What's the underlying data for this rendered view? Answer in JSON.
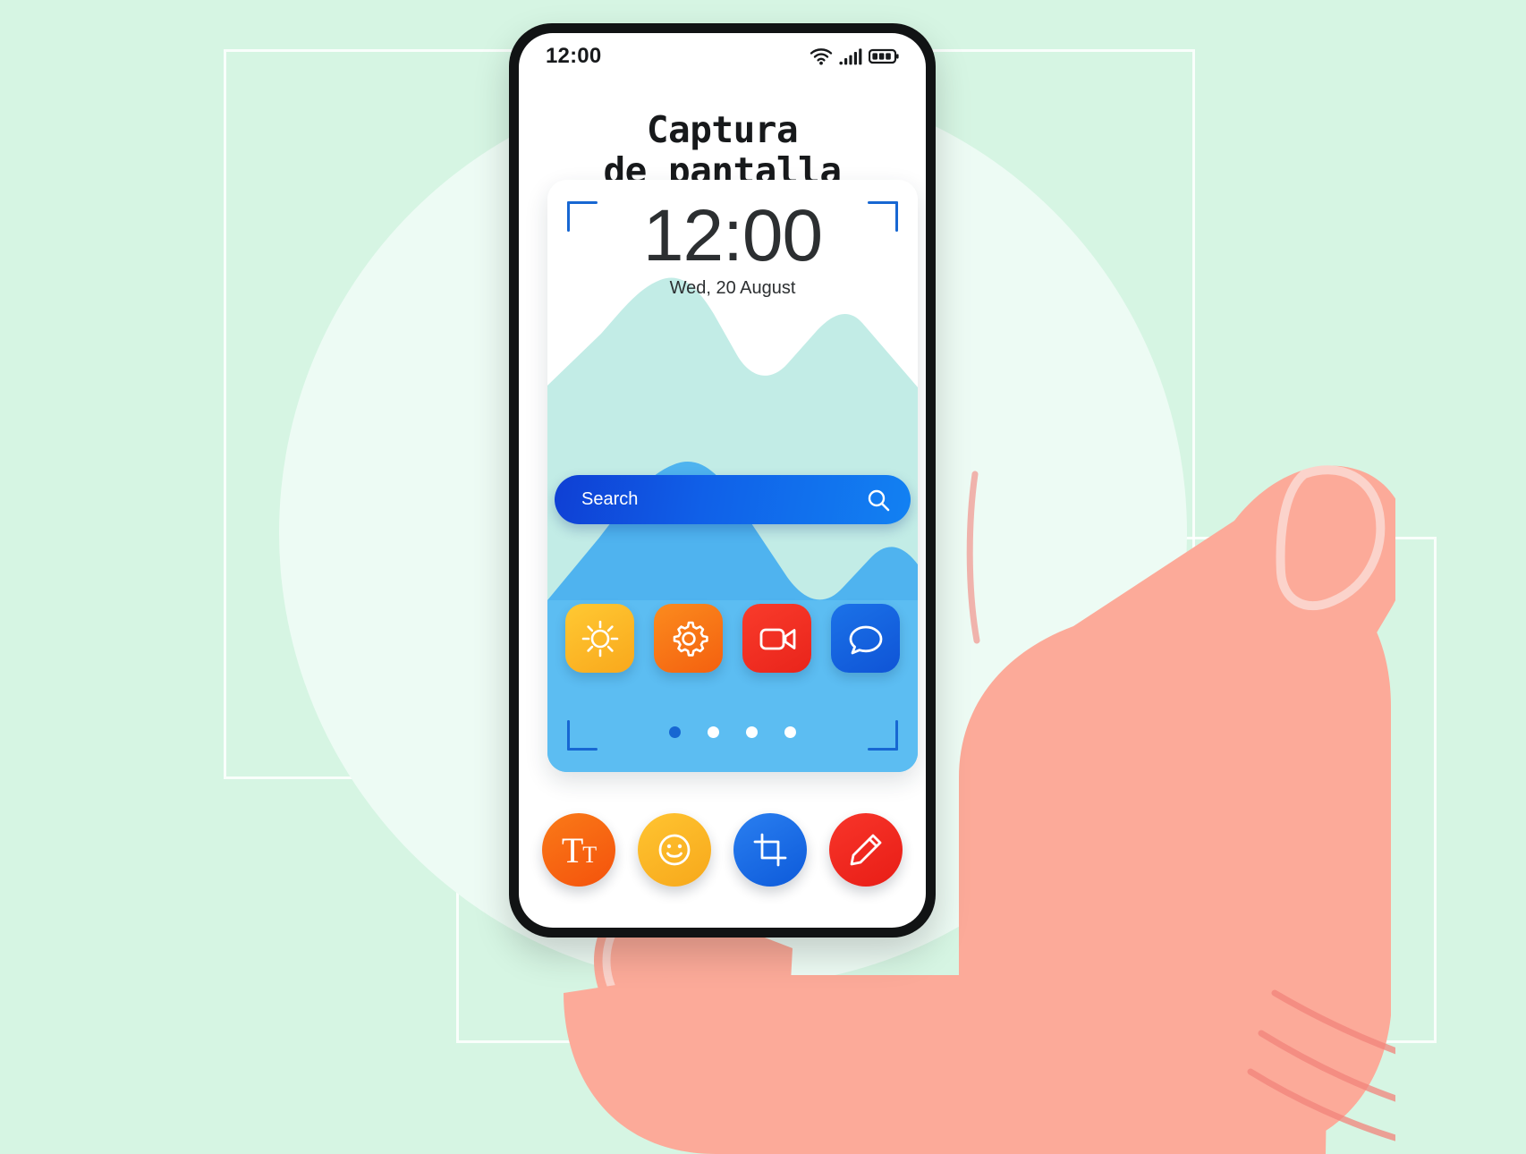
{
  "page": {
    "background_color": "#d6f5e3",
    "circle_color": "#edfbf4"
  },
  "phone": {
    "statusbar": {
      "time": "12:00",
      "wifi_icon": "wifi-icon",
      "signal_icon": "cellular-signal-icon",
      "battery_icon": "battery-icon"
    },
    "title_line1": "Captura",
    "title_line2": "de pantalla"
  },
  "screenshot_card": {
    "clock": {
      "time": "12:00",
      "date": "Wed, 20 August"
    },
    "brackets": {
      "color": "#1767d2",
      "names": [
        "crop-bracket-top-left",
        "crop-bracket-top-right",
        "crop-bracket-bottom-left",
        "crop-bracket-bottom-right"
      ]
    },
    "search": {
      "placeholder": "Search",
      "icon": "search-icon",
      "accent": "#1060e8"
    },
    "apps": [
      {
        "name": "brightness-app",
        "icon": "sun-icon",
        "color_from": "#ffc933",
        "color_to": "#f9a81c"
      },
      {
        "name": "settings-app",
        "icon": "gear-icon",
        "color_from": "#fb8b1e",
        "color_to": "#f4600f"
      },
      {
        "name": "camera-app",
        "icon": "video-camera-icon",
        "color_from": "#f93b2b",
        "color_to": "#e9241b"
      },
      {
        "name": "messages-app",
        "icon": "chat-bubble-icon",
        "color_from": "#1b72e8",
        "color_to": "#0f54d6"
      }
    ],
    "page_dots": {
      "count": 4,
      "active_index": 0,
      "active_color": "#1767d2",
      "inactive_color": "#ffffff"
    },
    "wallpaper": {
      "sky_color": "#ffffff",
      "back_mountain_color": "#c2ece6",
      "front_mountain_color": "#4fb3ef",
      "ground_color": "#5cbdf2"
    }
  },
  "toolbar": [
    {
      "name": "text-tool",
      "icon": "text-format-icon",
      "label": "T",
      "label_small": "T",
      "color_from": "#fa7a18",
      "color_to": "#f4520c"
    },
    {
      "name": "sticker-tool",
      "icon": "smiley-face-icon",
      "color_from": "#ffc431",
      "color_to": "#f7a81b"
    },
    {
      "name": "crop-tool",
      "icon": "crop-icon",
      "color_from": "#2a7ff0",
      "color_to": "#0d5ada"
    },
    {
      "name": "draw-tool",
      "icon": "pencil-icon",
      "color_from": "#f8352a",
      "color_to": "#e81d16"
    }
  ],
  "hand": {
    "skin_color": "#fcaa99",
    "outline_color": "#fbd3cb",
    "crease_color": "#f2837b"
  }
}
